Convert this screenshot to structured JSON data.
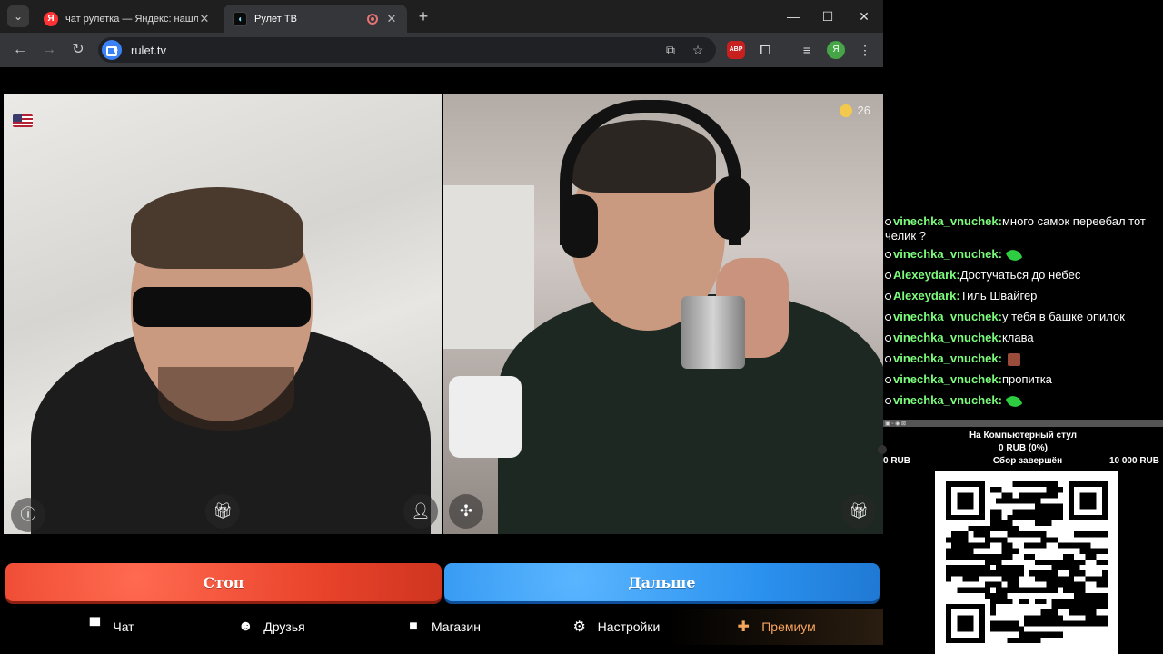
{
  "browser": {
    "tabs": [
      {
        "title": "чат рулетка — Яндекс: нашлось",
        "favicon": "yandex-icon",
        "active": false
      },
      {
        "title": "Рулет ТВ",
        "favicon": "rulet-icon",
        "active": true
      }
    ],
    "address": "rulet.tv",
    "extension_abp": "ABP",
    "profile_initial": "Я"
  },
  "page": {
    "coins": "26",
    "stop_label": "Стоп",
    "next_label": "Дальше",
    "nav": [
      {
        "label": "Чат",
        "icon": "chat-icon"
      },
      {
        "label": "Друзья",
        "icon": "friends-icon"
      },
      {
        "label": "Магазин",
        "icon": "shop-icon"
      },
      {
        "label": "Настройки",
        "icon": "gear-icon"
      },
      {
        "label": "Премиум",
        "icon": "tag-icon"
      }
    ],
    "colors": {
      "stop": "#e9432b",
      "next": "#2b92ef",
      "premium": "#f6a55d"
    }
  },
  "chat": {
    "messages": [
      {
        "user": "vinechka_vnuchek:",
        "text": "много самок переебал тот челик ?",
        "emote": ""
      },
      {
        "user": "vinechka_vnuchek:",
        "text": "",
        "emote": "leaf"
      },
      {
        "user": "Alexeydark:",
        "text": "Достучаться до небес",
        "emote": ""
      },
      {
        "user": "Alexeydark:",
        "text": "Тиль Швайгер",
        "emote": ""
      },
      {
        "user": "vinechka_vnuchek:",
        "text": "у тебя в башке опилок",
        "emote": ""
      },
      {
        "user": "vinechka_vnuchek:",
        "text": "клава",
        "emote": ""
      },
      {
        "user": "vinechka_vnuchek:",
        "text": "",
        "emote": "picture"
      },
      {
        "user": "vinechka_vnuchek:",
        "text": "пропитка",
        "emote": ""
      },
      {
        "user": "vinechka_vnuchek:",
        "text": "",
        "emote": "leaf"
      }
    ]
  },
  "donation": {
    "title": "На Компьютерный стул",
    "amount": "0 RUB (0%)",
    "min": "0 RUB",
    "status": "Сбор завершён",
    "max": "10 000 RUB",
    "progress": 0
  }
}
